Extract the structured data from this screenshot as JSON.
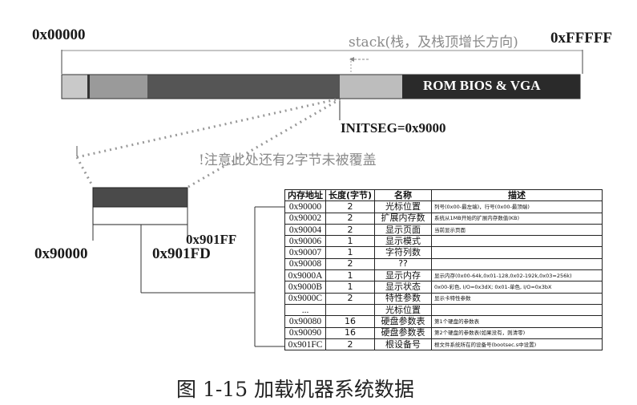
{
  "memory_bar": {
    "start_addr": "0x00000",
    "end_addr": "0xFFFFF",
    "rom_label": "ROM BIOS & VGA",
    "stack_note": "stack(栈，及栈顶增长方向)",
    "initseg_label": "INITSEG=0x9000"
  },
  "zoom": {
    "warning": "!注意此处还有2字节未被覆盖",
    "addr_start": "0x90000",
    "addr_fd": "0x901FD",
    "addr_ff": "0x901FF"
  },
  "table": {
    "headers": [
      "内存地址",
      "长度(字节)",
      "名称",
      "描述"
    ],
    "rows": [
      {
        "addr": "0x90000",
        "len": "2",
        "name": "光标位置",
        "desc": "列号(0x00-最左端)，行号(0x00-最顶端)"
      },
      {
        "addr": "0x90002",
        "len": "2",
        "name": "扩展内存数",
        "desc": "系统从1MB开始的扩展内存数值(KB)"
      },
      {
        "addr": "0x90004",
        "len": "2",
        "name": "显示页面",
        "desc": "当前显示页面"
      },
      {
        "addr": "0x90006",
        "len": "1",
        "name": "显示模式",
        "desc": ""
      },
      {
        "addr": "0x90007",
        "len": "1",
        "name": "字符列数",
        "desc": ""
      },
      {
        "addr": "0x90008",
        "len": "2",
        "name": "??",
        "desc": ""
      },
      {
        "addr": "0x9000A",
        "len": "1",
        "name": "显示内存",
        "desc": "显示内存(0x00-64k,0x01-128,0x02-192k,0x03=256k)"
      },
      {
        "addr": "0x9000B",
        "len": "1",
        "name": "显示状态",
        "desc": "0x00-彩色, I/O=0x3dX; 0x01-单色, I/O=0x3bX"
      },
      {
        "addr": "0x9000C",
        "len": "2",
        "name": "特性参数",
        "desc": "显示卡特性参数"
      },
      {
        "addr": "...",
        "len": "",
        "name": "光标位置",
        "desc": ""
      },
      {
        "addr": "0x90080",
        "len": "16",
        "name": "硬盘参数表",
        "desc": "第1个硬盘的参数表"
      },
      {
        "addr": "0x90090",
        "len": "16",
        "name": "硬盘参数表",
        "desc": "第2个硬盘的参数表(如果没有，则清零)"
      },
      {
        "addr": "0x901FC",
        "len": "2",
        "name": "根设备号",
        "desc": "根文件系统所在的设备号(bootsec.s中设置)"
      }
    ]
  },
  "caption": "图 1-15    加载机器系统数据"
}
